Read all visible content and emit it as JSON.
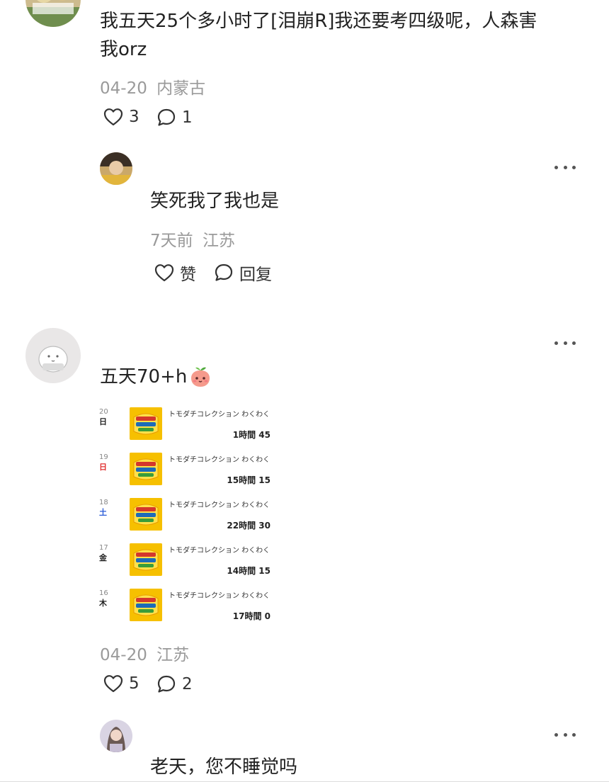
{
  "comments": [
    {
      "text": "我五天25个多小时了[泪崩R]我还要考四级呢，人森害我orz",
      "line1": "我五天25个多小时了[泪崩R]我还要考四级呢，人森害",
      "line2": "我orz",
      "date": "04-20",
      "location": "内蒙古",
      "likes": "3",
      "replies": "1"
    },
    {
      "text": "笑死我了我也是",
      "date": "7天前",
      "location": "江苏",
      "like_label": "赞",
      "reply_label": "回复"
    },
    {
      "text": "五天70+h",
      "date": "04-20",
      "location": "江苏",
      "likes": "5",
      "replies": "2",
      "screenshot_rows": [
        {
          "date": "20",
          "day": "日",
          "title": "トモダチコレクション わくわく",
          "time": "1時間 45"
        },
        {
          "date": "19",
          "day": "日",
          "title": "トモダチコレクション わくわく",
          "time": "15時間 15"
        },
        {
          "date": "18",
          "day": "土",
          "title": "トモダチコレクション わくわく",
          "time": "22時間 30"
        },
        {
          "date": "17",
          "day": "金",
          "title": "トモダチコレクション わくわく",
          "time": "14時間 15"
        },
        {
          "date": "16",
          "day": "木",
          "title": "トモダチコレクション わくわく",
          "time": "17時間 0"
        }
      ]
    },
    {
      "text": "老天，您不睡觉吗"
    }
  ],
  "colors": {
    "text": "#222222",
    "meta": "#9a9a9a",
    "icon_yellow": "#f5c400",
    "day_red": "#e03030",
    "day_blue": "#2a5bd7"
  },
  "icons": [
    "heart-outline-icon",
    "chat-bubble-icon",
    "more-dots-icon",
    "peach-emoji-icon"
  ]
}
